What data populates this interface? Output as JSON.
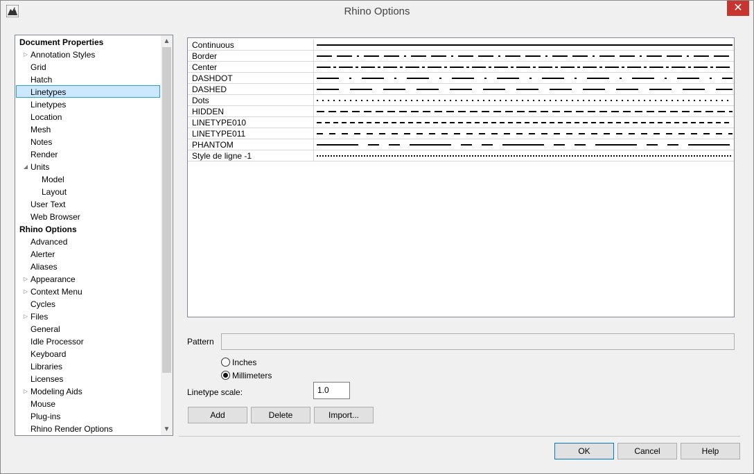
{
  "window": {
    "title": "Rhino Options",
    "close_glyph": "✕"
  },
  "tree": {
    "items": [
      {
        "label": "Document Properties",
        "header": true,
        "level": 0
      },
      {
        "label": "Annotation Styles",
        "level": 1,
        "expander": "collapsed"
      },
      {
        "label": "Grid",
        "level": 1
      },
      {
        "label": "Hatch",
        "level": 1
      },
      {
        "label": "Linetypes",
        "level": 1,
        "selected": true
      },
      {
        "label": "Linetypes",
        "level": 1
      },
      {
        "label": "Location",
        "level": 1
      },
      {
        "label": "Mesh",
        "level": 1
      },
      {
        "label": "Notes",
        "level": 1
      },
      {
        "label": "Render",
        "level": 1
      },
      {
        "label": "Units",
        "level": 1,
        "expander": "expanded"
      },
      {
        "label": "Model",
        "level": 2
      },
      {
        "label": "Layout",
        "level": 2
      },
      {
        "label": "User Text",
        "level": 1
      },
      {
        "label": "Web Browser",
        "level": 1
      },
      {
        "label": "Rhino Options",
        "header": true,
        "level": 0
      },
      {
        "label": "Advanced",
        "level": 1
      },
      {
        "label": "Alerter",
        "level": 1
      },
      {
        "label": "Aliases",
        "level": 1
      },
      {
        "label": "Appearance",
        "level": 1,
        "expander": "collapsed"
      },
      {
        "label": "Context Menu",
        "level": 1,
        "expander": "collapsed"
      },
      {
        "label": "Cycles",
        "level": 1
      },
      {
        "label": "Files",
        "level": 1,
        "expander": "collapsed"
      },
      {
        "label": "General",
        "level": 1
      },
      {
        "label": "Idle Processor",
        "level": 1
      },
      {
        "label": "Keyboard",
        "level": 1
      },
      {
        "label": "Libraries",
        "level": 1
      },
      {
        "label": "Licenses",
        "level": 1
      },
      {
        "label": "Modeling Aids",
        "level": 1,
        "expander": "collapsed"
      },
      {
        "label": "Mouse",
        "level": 1
      },
      {
        "label": "Plug-ins",
        "level": 1
      },
      {
        "label": "Rhino Render Options",
        "level": 1
      }
    ]
  },
  "linetypes": [
    {
      "name": "Continuous",
      "pattern": "continuous"
    },
    {
      "name": "Border",
      "pattern": "border"
    },
    {
      "name": "Center",
      "pattern": "center"
    },
    {
      "name": "DASHDOT",
      "pattern": "dashdot"
    },
    {
      "name": "DASHED",
      "pattern": "dashed"
    },
    {
      "name": "Dots",
      "pattern": "dots"
    },
    {
      "name": "HIDDEN",
      "pattern": "hidden"
    },
    {
      "name": "LINETYPE010",
      "pattern": "linetype010"
    },
    {
      "name": "LINETYPE011",
      "pattern": "linetype011"
    },
    {
      "name": "PHANTOM",
      "pattern": "phantom"
    },
    {
      "name": "Style de ligne -1",
      "pattern": "fine-dots"
    }
  ],
  "pattern": {
    "label": "Pattern",
    "value": ""
  },
  "units": {
    "inches": "Inches",
    "millimeters": "Millimeters",
    "selected": "millimeters"
  },
  "scale": {
    "label": "Linetype scale:",
    "value": "1.0"
  },
  "buttons": {
    "add": "Add",
    "delete": "Delete",
    "import": "Import...",
    "ok": "OK",
    "cancel": "Cancel",
    "help": "Help"
  },
  "icons": {
    "app": "rhino-logo-icon",
    "close": "close-icon",
    "scroll_up": "scroll-up-arrow-icon",
    "scroll_down": "scroll-down-arrow-icon"
  }
}
